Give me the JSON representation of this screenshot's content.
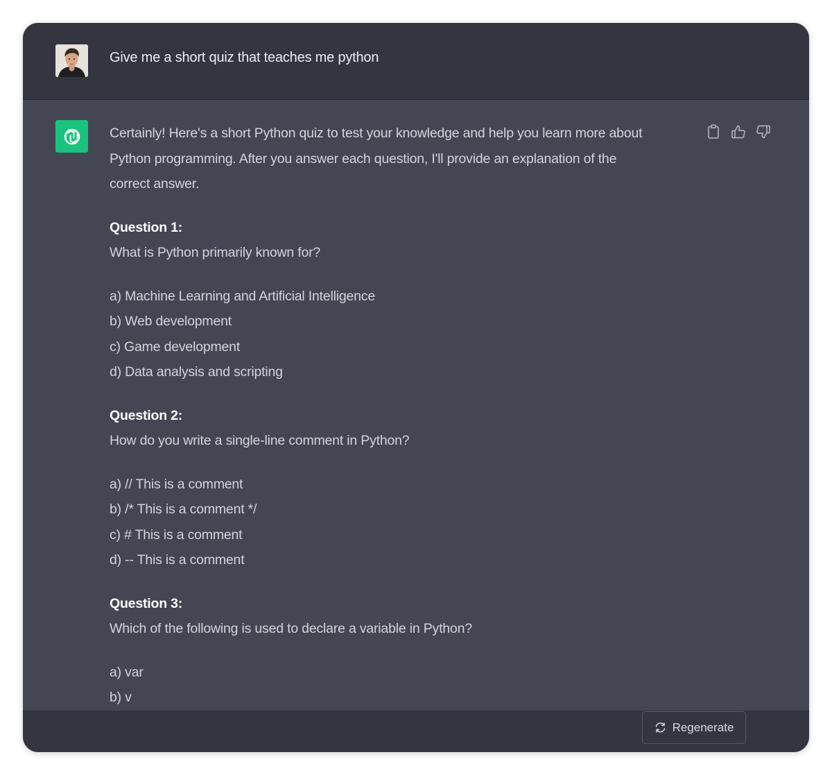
{
  "user_message": {
    "avatar_icon": "user-photo-icon",
    "text": "Give me a short quiz that teaches me python"
  },
  "assistant_message": {
    "avatar_icon": "openai-logo-icon",
    "intro_lines": [
      "Certainly! Here's a short Python quiz to test your knowledge and help you learn more about",
      "Python programming. After you answer each question, I'll provide an explanation of the",
      "correct answer."
    ],
    "questions": [
      {
        "heading": "Question 1:",
        "prompt": "What is Python primarily known for?",
        "options": [
          "a) Machine Learning and Artificial Intelligence",
          "b) Web development",
          "c) Game development",
          "d) Data analysis and scripting"
        ]
      },
      {
        "heading": "Question 2:",
        "prompt": "How do you write a single-line comment in Python?",
        "options": [
          "a) // This is a comment",
          "b) /* This is a comment */",
          "c) # This is a comment",
          "d) -- This is a comment"
        ]
      },
      {
        "heading": "Question 3:",
        "prompt": "Which of the following is used to declare a variable in Python?",
        "options": [
          "a) var",
          "b) v"
        ]
      }
    ],
    "actions": [
      "copy-icon",
      "thumbs-up-icon",
      "thumbs-down-icon"
    ]
  },
  "bottom_bar": {
    "regenerate_label": "Regenerate",
    "regenerate_icon": "refresh-icon"
  },
  "colors": {
    "user_bg": "#343541",
    "assistant_bg": "#444654",
    "gpt_green": "#19c37d",
    "text": "#d1d5db"
  }
}
